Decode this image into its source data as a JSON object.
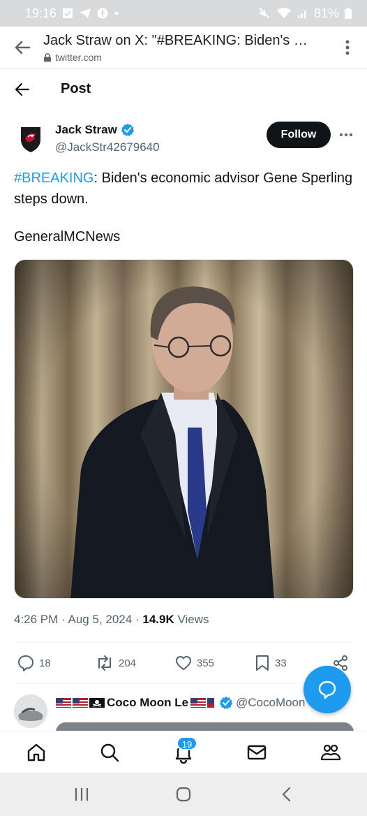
{
  "status_bar": {
    "time": "19:16",
    "battery": "81%",
    "left_icons": [
      "check-square-icon",
      "telegram-icon",
      "facebook-icon",
      "dot-icon"
    ],
    "right_icons": [
      "mute-icon",
      "wifi-icon",
      "signal-icon",
      "battery-icon"
    ]
  },
  "browser": {
    "title": "Jack Straw on X: \"#BREAKING: Biden's e...",
    "url": "twitter.com"
  },
  "header": {
    "title": "Post"
  },
  "author": {
    "name": "Jack Straw",
    "handle": "@JackStr42679640",
    "follow_label": "Follow"
  },
  "tweet": {
    "hashtag": "#BREAKING",
    "text": ": Biden's economic advisor Gene Sperling steps down.",
    "source": "GeneralMCNews"
  },
  "meta": {
    "time": "4:26 PM",
    "date": "Aug 5, 2024",
    "views_count": "14.9K",
    "views_label": "Views",
    "separator": "·"
  },
  "actions": {
    "replies": "18",
    "reposts": "204",
    "likes": "355",
    "bookmarks": "33"
  },
  "reply_preview": {
    "name": "Coco Moon Le",
    "handle": "@CocoMoon"
  },
  "tabs": {
    "notifications_badge": "19"
  },
  "colors": {
    "accent": "#1d9bf0",
    "text": "#0f1419",
    "muted": "#536471"
  }
}
